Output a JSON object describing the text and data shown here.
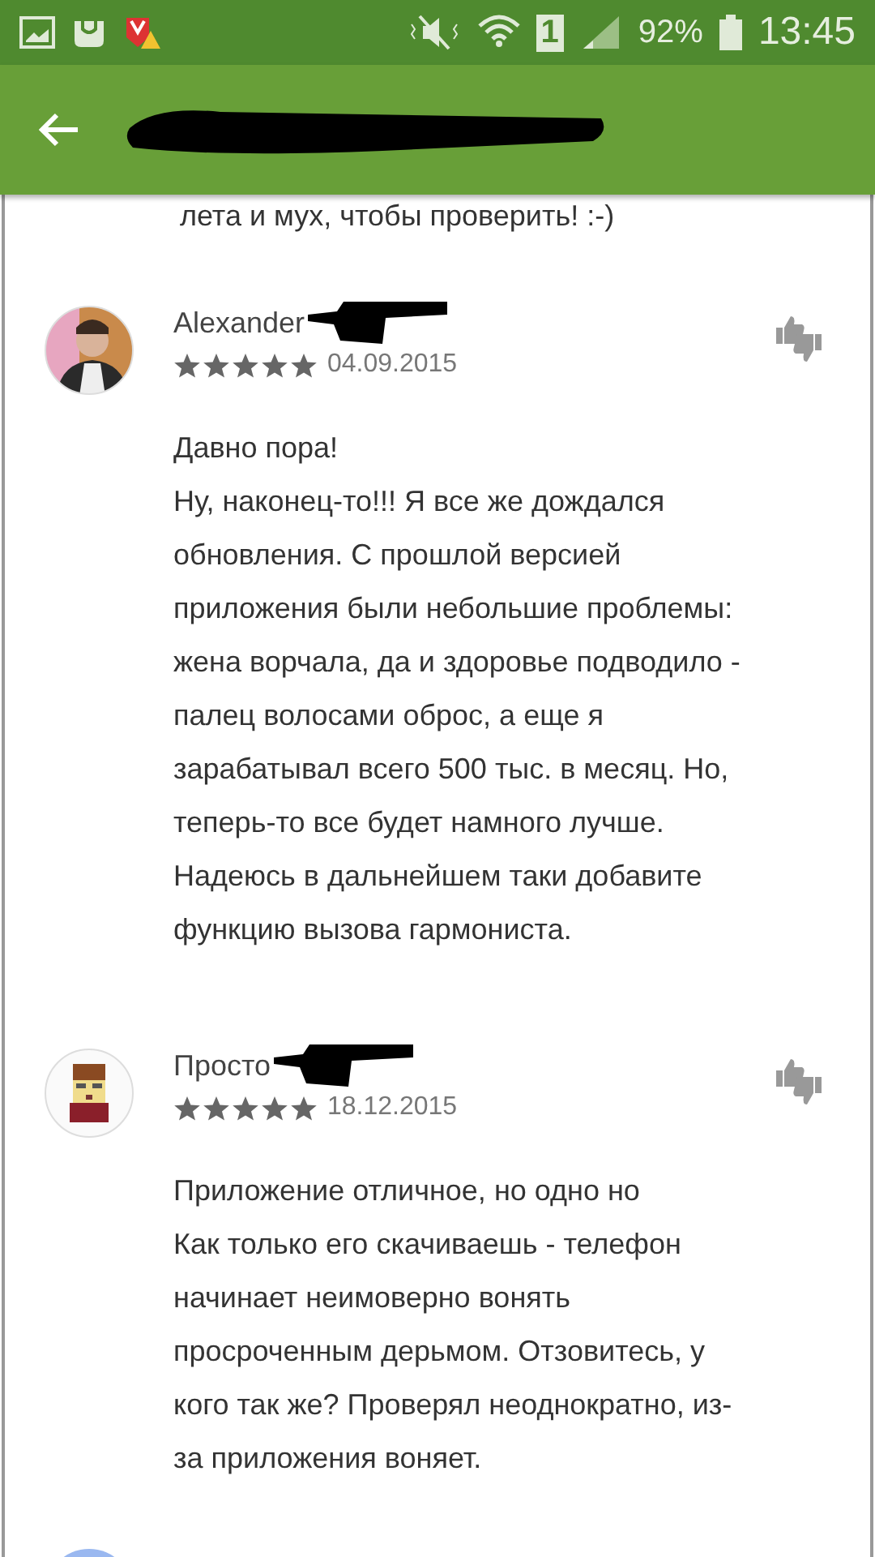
{
  "status_bar": {
    "battery": "92%",
    "time": "13:45",
    "sim": "1"
  },
  "app_bar": {
    "title_redacted": true
  },
  "top_text": "лета и мух, чтобы проверить! :-)",
  "reviews": [
    {
      "author": "Alexander",
      "author_redacted": true,
      "stars": 5,
      "date": "04.09.2015",
      "avatar": {
        "kind": "photo"
      },
      "title": "Давно пора!",
      "body": "Ну, наконец-то!!! Я все же дождался обновления. С прошлой версией приложения были небольшие проблемы: жена ворчала, да и здоровье подводило - палец волосами оброс, а еще я зарабатывал всего 500 тыс. в месяц. Но, теперь-то все будет намного лучше. Надеюсь в дальнейшем таки добавите функцию вызова гармониста."
    },
    {
      "author": "Просто",
      "author_redacted": true,
      "stars": 5,
      "date": "18.12.2015",
      "avatar": {
        "kind": "pixel"
      },
      "title": "Приложение отличное, но одно но",
      "body": "Как только его скачиваешь - телефон начинает неимоверно вонять просроченным дерьмом. Отзовитесь, у кого так же? Проверял неоднократно, из-за приложения воняет."
    },
    {
      "avatar": {
        "kind": "plain"
      }
    }
  ]
}
